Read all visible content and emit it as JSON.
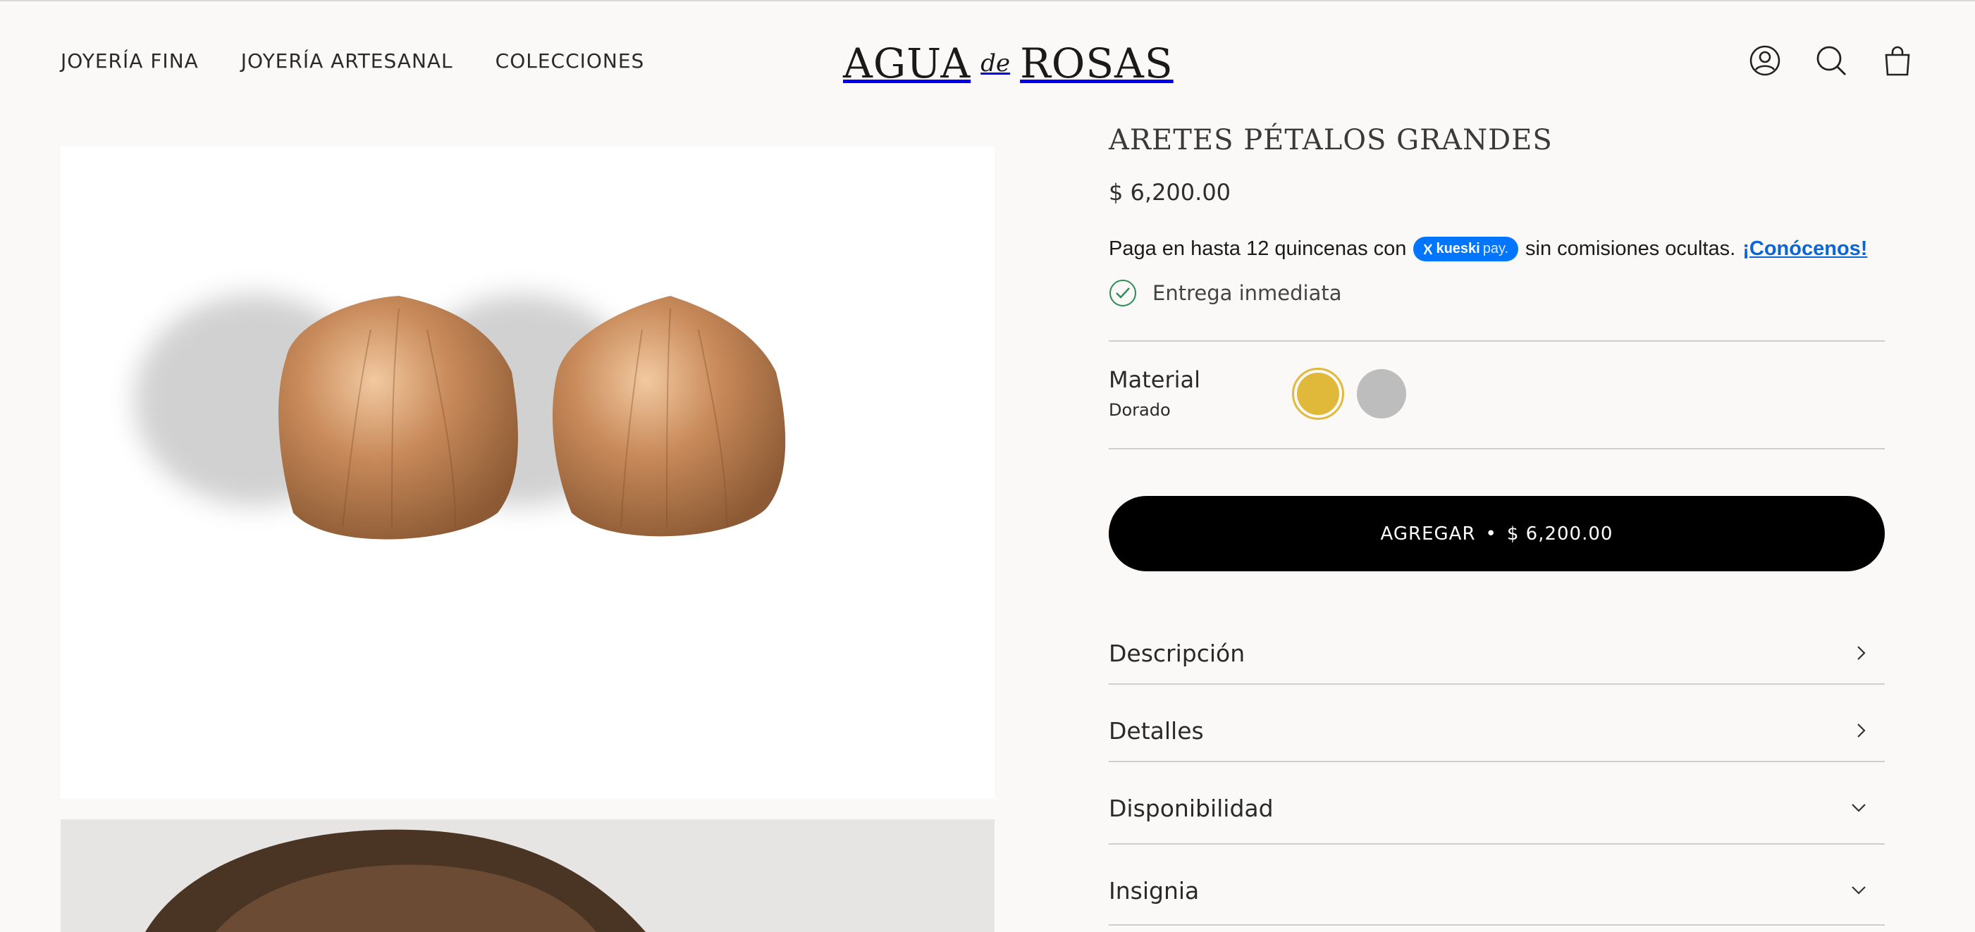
{
  "header": {
    "nav": [
      "JOYERÍA FINA",
      "JOYERÍA ARTESANAL",
      "COLECCIONES"
    ],
    "logo": {
      "left": "AGUA",
      "middle": "de",
      "right": "ROSAS"
    },
    "icons": [
      "account-icon",
      "search-icon",
      "cart-icon"
    ]
  },
  "product": {
    "title": "ARETES PÉTALOS GRANDES",
    "price": "$ 6,200.00",
    "payment": {
      "before": "Paga en hasta 12 quincenas con",
      "badge_brand": "kueski",
      "badge_suffix": "pay.",
      "after": "sin comisiones ocultas.",
      "link": "¡Conócenos!"
    },
    "stock_status": "Entrega inmediata",
    "material": {
      "label": "Material",
      "selected": "Dorado",
      "swatches": [
        {
          "name": "Dorado",
          "color": "#e0b93a",
          "selected": true
        },
        {
          "name": "Plateado",
          "color": "#bdbdbd",
          "selected": false
        }
      ]
    },
    "add_button": {
      "label": "AGREGAR",
      "separator": "•",
      "price": "$ 6,200.00"
    },
    "accordions": [
      {
        "label": "Descripción",
        "icon": "chevron-right-icon"
      },
      {
        "label": "Detalles",
        "icon": "chevron-right-icon"
      },
      {
        "label": "Disponibilidad",
        "icon": "chevron-down-icon"
      },
      {
        "label": "Insignia",
        "icon": "chevron-down-icon"
      }
    ]
  },
  "colors": {
    "accent_gold": "#e0b93a",
    "link": "#0a66d6",
    "kueski_blue": "#0075ff",
    "button": "#000000"
  }
}
